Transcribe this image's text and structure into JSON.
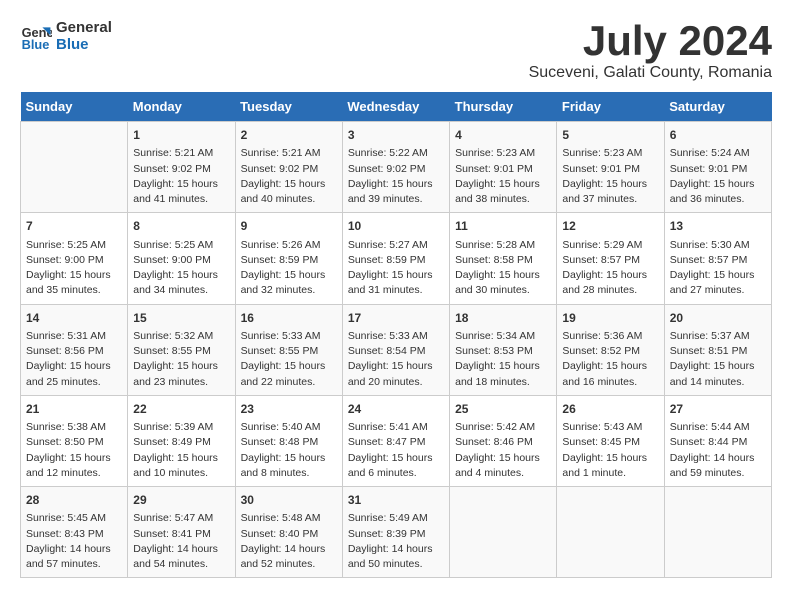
{
  "logo": {
    "line1": "General",
    "line2": "Blue"
  },
  "title": "July 2024",
  "subtitle": "Suceveni, Galati County, Romania",
  "days_of_week": [
    "Sunday",
    "Monday",
    "Tuesday",
    "Wednesday",
    "Thursday",
    "Friday",
    "Saturday"
  ],
  "weeks": [
    [
      {
        "day": "",
        "info": ""
      },
      {
        "day": "1",
        "info": "Sunrise: 5:21 AM\nSunset: 9:02 PM\nDaylight: 15 hours\nand 41 minutes."
      },
      {
        "day": "2",
        "info": "Sunrise: 5:21 AM\nSunset: 9:02 PM\nDaylight: 15 hours\nand 40 minutes."
      },
      {
        "day": "3",
        "info": "Sunrise: 5:22 AM\nSunset: 9:02 PM\nDaylight: 15 hours\nand 39 minutes."
      },
      {
        "day": "4",
        "info": "Sunrise: 5:23 AM\nSunset: 9:01 PM\nDaylight: 15 hours\nand 38 minutes."
      },
      {
        "day": "5",
        "info": "Sunrise: 5:23 AM\nSunset: 9:01 PM\nDaylight: 15 hours\nand 37 minutes."
      },
      {
        "day": "6",
        "info": "Sunrise: 5:24 AM\nSunset: 9:01 PM\nDaylight: 15 hours\nand 36 minutes."
      }
    ],
    [
      {
        "day": "7",
        "info": "Sunrise: 5:25 AM\nSunset: 9:00 PM\nDaylight: 15 hours\nand 35 minutes."
      },
      {
        "day": "8",
        "info": "Sunrise: 5:25 AM\nSunset: 9:00 PM\nDaylight: 15 hours\nand 34 minutes."
      },
      {
        "day": "9",
        "info": "Sunrise: 5:26 AM\nSunset: 8:59 PM\nDaylight: 15 hours\nand 32 minutes."
      },
      {
        "day": "10",
        "info": "Sunrise: 5:27 AM\nSunset: 8:59 PM\nDaylight: 15 hours\nand 31 minutes."
      },
      {
        "day": "11",
        "info": "Sunrise: 5:28 AM\nSunset: 8:58 PM\nDaylight: 15 hours\nand 30 minutes."
      },
      {
        "day": "12",
        "info": "Sunrise: 5:29 AM\nSunset: 8:57 PM\nDaylight: 15 hours\nand 28 minutes."
      },
      {
        "day": "13",
        "info": "Sunrise: 5:30 AM\nSunset: 8:57 PM\nDaylight: 15 hours\nand 27 minutes."
      }
    ],
    [
      {
        "day": "14",
        "info": "Sunrise: 5:31 AM\nSunset: 8:56 PM\nDaylight: 15 hours\nand 25 minutes."
      },
      {
        "day": "15",
        "info": "Sunrise: 5:32 AM\nSunset: 8:55 PM\nDaylight: 15 hours\nand 23 minutes."
      },
      {
        "day": "16",
        "info": "Sunrise: 5:33 AM\nSunset: 8:55 PM\nDaylight: 15 hours\nand 22 minutes."
      },
      {
        "day": "17",
        "info": "Sunrise: 5:33 AM\nSunset: 8:54 PM\nDaylight: 15 hours\nand 20 minutes."
      },
      {
        "day": "18",
        "info": "Sunrise: 5:34 AM\nSunset: 8:53 PM\nDaylight: 15 hours\nand 18 minutes."
      },
      {
        "day": "19",
        "info": "Sunrise: 5:36 AM\nSunset: 8:52 PM\nDaylight: 15 hours\nand 16 minutes."
      },
      {
        "day": "20",
        "info": "Sunrise: 5:37 AM\nSunset: 8:51 PM\nDaylight: 15 hours\nand 14 minutes."
      }
    ],
    [
      {
        "day": "21",
        "info": "Sunrise: 5:38 AM\nSunset: 8:50 PM\nDaylight: 15 hours\nand 12 minutes."
      },
      {
        "day": "22",
        "info": "Sunrise: 5:39 AM\nSunset: 8:49 PM\nDaylight: 15 hours\nand 10 minutes."
      },
      {
        "day": "23",
        "info": "Sunrise: 5:40 AM\nSunset: 8:48 PM\nDaylight: 15 hours\nand 8 minutes."
      },
      {
        "day": "24",
        "info": "Sunrise: 5:41 AM\nSunset: 8:47 PM\nDaylight: 15 hours\nand 6 minutes."
      },
      {
        "day": "25",
        "info": "Sunrise: 5:42 AM\nSunset: 8:46 PM\nDaylight: 15 hours\nand 4 minutes."
      },
      {
        "day": "26",
        "info": "Sunrise: 5:43 AM\nSunset: 8:45 PM\nDaylight: 15 hours\nand 1 minute."
      },
      {
        "day": "27",
        "info": "Sunrise: 5:44 AM\nSunset: 8:44 PM\nDaylight: 14 hours\nand 59 minutes."
      }
    ],
    [
      {
        "day": "28",
        "info": "Sunrise: 5:45 AM\nSunset: 8:43 PM\nDaylight: 14 hours\nand 57 minutes."
      },
      {
        "day": "29",
        "info": "Sunrise: 5:47 AM\nSunset: 8:41 PM\nDaylight: 14 hours\nand 54 minutes."
      },
      {
        "day": "30",
        "info": "Sunrise: 5:48 AM\nSunset: 8:40 PM\nDaylight: 14 hours\nand 52 minutes."
      },
      {
        "day": "31",
        "info": "Sunrise: 5:49 AM\nSunset: 8:39 PM\nDaylight: 14 hours\nand 50 minutes."
      },
      {
        "day": "",
        "info": ""
      },
      {
        "day": "",
        "info": ""
      },
      {
        "day": "",
        "info": ""
      }
    ]
  ]
}
